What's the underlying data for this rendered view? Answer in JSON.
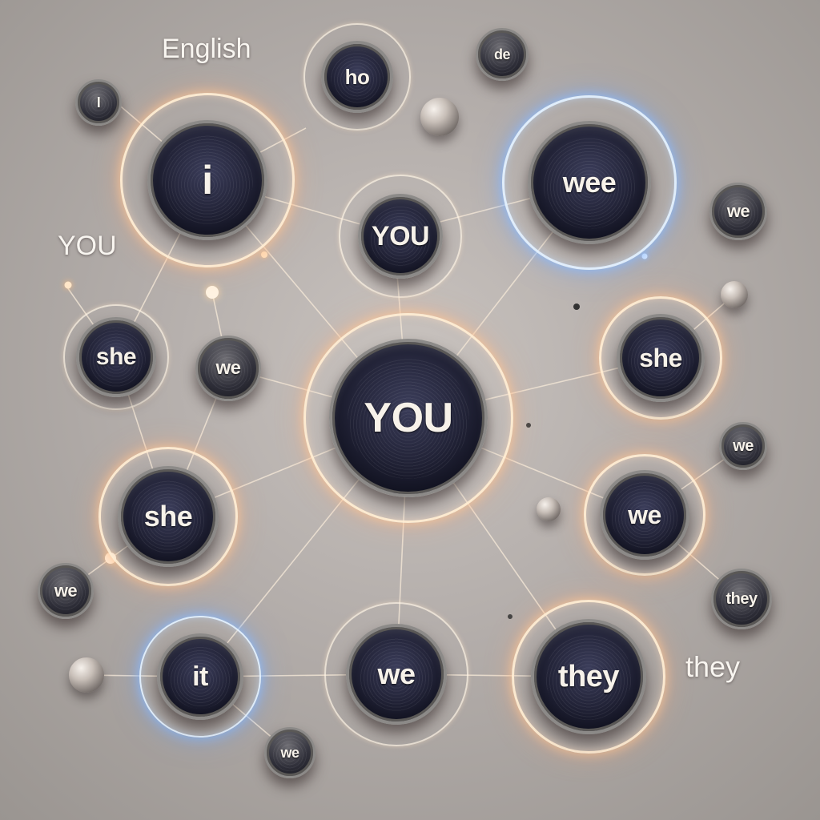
{
  "floating_labels": {
    "english": "English",
    "you": "YOU",
    "they": "they"
  },
  "nodes": {
    "top_ho": "ho",
    "top_de": "de",
    "top_left_small": "I",
    "i": "i",
    "you_top": "YOU",
    "wee": "wee",
    "we_right_top": "we",
    "she_left": "she",
    "we_mid_left": "we",
    "you_center": "YOU",
    "she_right": "she",
    "we_right_small": "we",
    "she_bottom_left": "she",
    "we_right_bottom": "we",
    "we_bottom_left_small": "we",
    "they_right_small": "they",
    "it": "it",
    "we_bottom": "we",
    "they_bottom": "they",
    "we_bottom_small": "we"
  },
  "colors": {
    "ring_warm": "#ffe8cf",
    "ring_cool": "#e1f0ff",
    "button_face": "#24253a",
    "connector": "#f3e6d6"
  }
}
